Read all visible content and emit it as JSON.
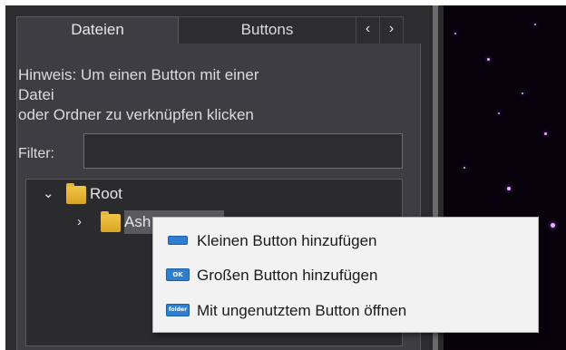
{
  "tabs": {
    "files_label": "Dateien",
    "buttons_label": "Buttons",
    "prev_glyph": "‹",
    "next_glyph": "›"
  },
  "hint": {
    "line1": "Hinweis: Um einen Button mit einer",
    "line2": "Datei",
    "line3": "oder Ordner zu verknüpfen klicken"
  },
  "filter": {
    "label": "Filter:",
    "value": ""
  },
  "tree": {
    "root_label": "Root",
    "child_label": "Ash"
  },
  "context_menu": {
    "items": [
      {
        "label": "Kleinen Button hinzufügen",
        "icon": "small-button-icon"
      },
      {
        "label": "Großen Button hinzufügen",
        "icon": "large-button-icon",
        "icon_text": "OK"
      },
      {
        "label": "Mit ungenutztem Button öffnen",
        "icon": "unused-button-icon",
        "icon_text": "folder"
      }
    ]
  },
  "colors": {
    "window_bg": "#2d2d30",
    "panel_bg": "#3e3e42",
    "menu_bg": "#f2f2f2",
    "icon_blue": "#2f7fd0",
    "folder_yellow": "#e6b53a",
    "star_pink": "#e5b2ff"
  }
}
